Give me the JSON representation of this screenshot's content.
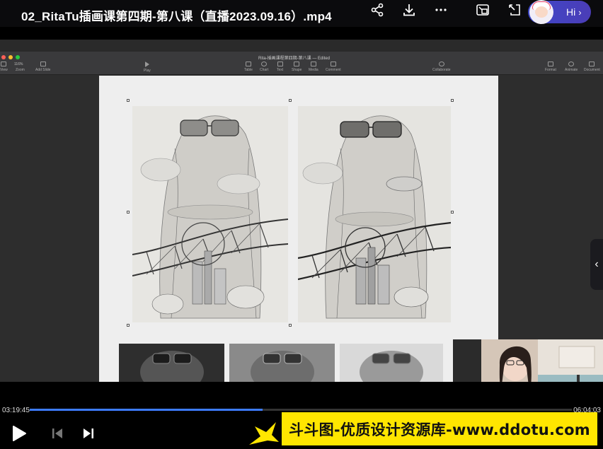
{
  "header": {
    "title": "02_RitaTu插画课第四期-第八课（直播2023.09.16）.mp4",
    "icons": [
      "share-icon",
      "download-icon",
      "more-icon",
      "picture-in-picture-icon",
      "popout-icon"
    ],
    "assistant_label": "Hi"
  },
  "keynote": {
    "doc_title": "Rita-插画课程第四期-第八课 — Edited",
    "zoom": "116%",
    "toolbar": [
      {
        "label": "View"
      },
      {
        "label": "Zoom"
      },
      {
        "label": "Add Slide"
      },
      {
        "label": "Play"
      },
      {
        "label": "Table"
      },
      {
        "label": "Chart"
      },
      {
        "label": "Text"
      },
      {
        "label": "Shape"
      },
      {
        "label": "Media"
      },
      {
        "label": "Comment"
      },
      {
        "label": "Collaborate"
      },
      {
        "label": "Format"
      },
      {
        "label": "Animate"
      },
      {
        "label": "Document"
      }
    ]
  },
  "player": {
    "current_time": "03:19:45",
    "total_time": "06:04:03",
    "progress": 0.43
  },
  "watermark": {
    "text": "斗斗图-优质设计资源库-www.ddotu.com",
    "color": "#ffe600"
  }
}
